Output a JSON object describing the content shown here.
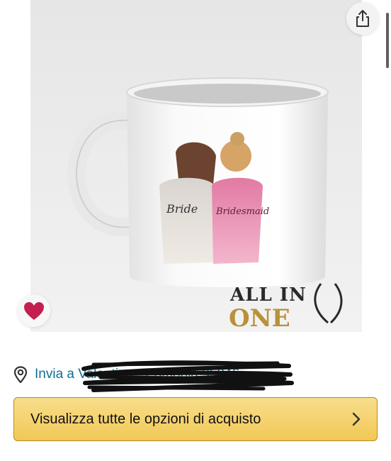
{
  "product": {
    "image_alt": "Bride and bridesmaid mug",
    "brand_logo_text": "ALL IN ONE",
    "mug_print_left": "Bride",
    "mug_print_right": "Bridesmaid"
  },
  "actions": {
    "share_icon": "share-icon",
    "favorite_icon": "heart-icon"
  },
  "delivery": {
    "label": "Invia a Valentina - Pomonia 95046",
    "icon": "location-pin-icon",
    "color": "#0f6f95"
  },
  "buy_options": {
    "label": "Visualizza tutte le opzioni di acquisto",
    "icon": "chevron-right-icon",
    "color": "#f1c856"
  },
  "colors": {
    "favorite": "#c4204f",
    "link": "#0f6f95"
  }
}
